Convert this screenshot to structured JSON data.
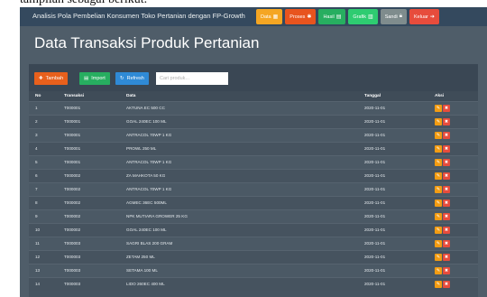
{
  "caption": "tampilan sebagai berikut.",
  "colors": {
    "navbar": "#34495e",
    "body": "#4f5d69",
    "data_btn": "#f5a623",
    "proses_btn": "#e8541e",
    "hasil_btn": "#27ae60",
    "grafik_btn": "#27ae60",
    "sandi_btn": "#7f8c8d",
    "keluar_btn": "#e74c3c",
    "tambah_btn": "#e8601c",
    "import_btn": "#27ae60",
    "refresh_btn": "#2f8ad6",
    "edit_btn": "#f39c12",
    "delete_btn": "#e74c3c"
  },
  "navbar": {
    "brand": "Analisis Pola Pembelian Konsumen Toko Pertanian dengan FP-Growth",
    "menu": [
      {
        "label": "Data",
        "icon": "table-icon"
      },
      {
        "label": "Proses",
        "icon": "gear-icon"
      },
      {
        "label": "Hasil",
        "icon": "file-icon"
      },
      {
        "label": "Grafik",
        "icon": "bar-chart-icon"
      },
      {
        "label": "Sandi",
        "icon": "lock-icon"
      },
      {
        "label": "Keluar",
        "icon": "sign-out-icon"
      }
    ]
  },
  "page": {
    "title": "Data Transaksi Produk Pertanian"
  },
  "toolbar": {
    "tambah_label": "Tambah",
    "import_label": "Import",
    "refresh_label": "Refresh",
    "search_placeholder": "Cari produk..."
  },
  "table": {
    "headers": [
      "No",
      "Transaksi",
      "Data",
      "Tanggal",
      "Aksi"
    ],
    "rows": [
      [
        "1",
        "T000001",
        "AKTUNA EC 500 CC",
        "2020-11-01"
      ],
      [
        "2",
        "T000001",
        "GOAL 240EC 100 ML",
        "2020-11-01"
      ],
      [
        "3",
        "T000001",
        "ANTRACOL 70WP 1 KG",
        "2020-11-01"
      ],
      [
        "4",
        "T000001",
        "PROWL 250 ML",
        "2020-11-01"
      ],
      [
        "5",
        "T000001",
        "ANTRACOL 70WP 1 KG",
        "2020-11-01"
      ],
      [
        "6",
        "T000002",
        "ZA MAHKOTA 50 KG",
        "2020-11-01"
      ],
      [
        "7",
        "T000002",
        "ANTRACOL 70WP 1 KG",
        "2020-11-01"
      ],
      [
        "8",
        "T000002",
        "AGMEC 36EC 500ML",
        "2020-11-01"
      ],
      [
        "9",
        "T000002",
        "NPK MUTIARA GROWER 25 KG",
        "2020-11-01"
      ],
      [
        "10",
        "T000002",
        "GOAL 240EC 100 ML",
        "2020-11-01"
      ],
      [
        "11",
        "T000003",
        "SAGRI BLAS 200 GRAM",
        "2020-11-01"
      ],
      [
        "12",
        "T000003",
        "ZETAM 250 ML",
        "2020-11-01"
      ],
      [
        "13",
        "T000003",
        "SETAMA 100 ML",
        "2020-11-01"
      ],
      [
        "14",
        "T000003",
        "LIDO 260EC 400 ML",
        "2020-11-01"
      ]
    ]
  }
}
